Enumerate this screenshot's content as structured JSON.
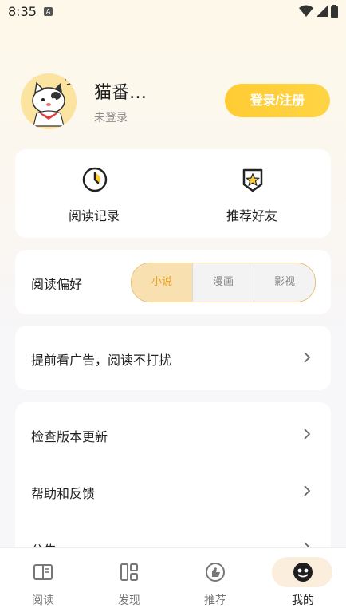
{
  "status_bar": {
    "time": "8:35",
    "app_icon": "A"
  },
  "profile": {
    "name": "猫番…",
    "status": "未登录",
    "login_button": "登录/注册"
  },
  "quick_actions": [
    {
      "label": "阅读记录",
      "icon": "clock-icon"
    },
    {
      "label": "推荐好友",
      "icon": "star-badge-icon"
    }
  ],
  "preference": {
    "label": "阅读偏好",
    "options": [
      "小说",
      "漫画",
      "影视"
    ],
    "selected": "小说"
  },
  "ad_row": {
    "label": "提前看广告，阅读不打扰"
  },
  "settings": [
    {
      "label": "检查版本更新"
    },
    {
      "label": "帮助和反馈"
    },
    {
      "label": "公告"
    }
  ],
  "bottom_nav": [
    {
      "label": "阅读",
      "icon": "book-icon"
    },
    {
      "label": "发现",
      "icon": "grid-icon"
    },
    {
      "label": "推荐",
      "icon": "thumb-icon"
    },
    {
      "label": "我的",
      "icon": "profile-icon",
      "active": true
    }
  ],
  "colors": {
    "accent": "#ffcc33",
    "active_text": "#f0a020"
  }
}
